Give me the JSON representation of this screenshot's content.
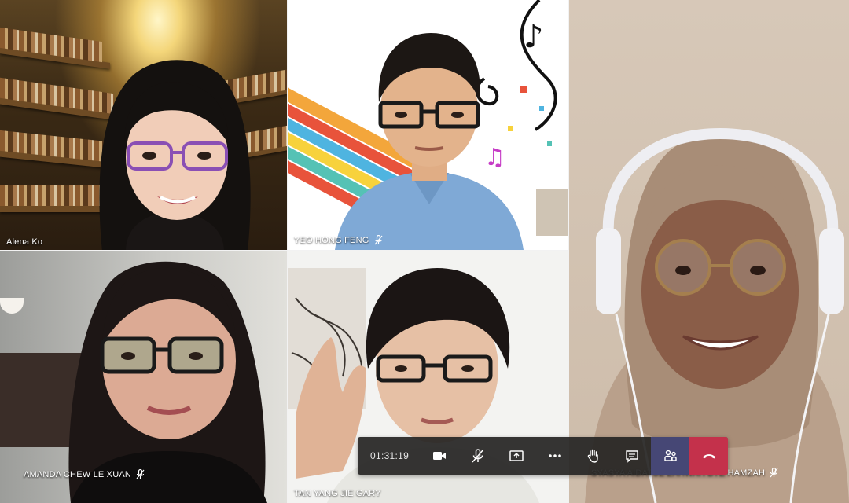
{
  "participants": [
    {
      "name": "Alena Ko",
      "muted": false
    },
    {
      "name": "YEO HONG FENG",
      "muted": true
    },
    {
      "name": "SYASYA AIDATUZ ZAHWAH BTE HAMZAH",
      "muted": true
    },
    {
      "name": "AMANDA CHEW LE XUAN",
      "muted": true
    },
    {
      "name": "TAN YANG JIE GARY",
      "muted": false
    }
  ],
  "call_controls": {
    "timer": "01:31:19",
    "buttons": [
      {
        "icon": "camera-icon"
      },
      {
        "icon": "mic-muted-icon"
      },
      {
        "icon": "share-screen-icon"
      },
      {
        "icon": "more-options-icon"
      },
      {
        "icon": "raise-hand-icon"
      },
      {
        "icon": "chat-icon"
      },
      {
        "icon": "participants-icon"
      },
      {
        "icon": "hang-up-icon"
      }
    ],
    "colors": {
      "bar": "#252423",
      "participants_bg": "#464775",
      "hangup_bg": "#c4314b"
    }
  }
}
